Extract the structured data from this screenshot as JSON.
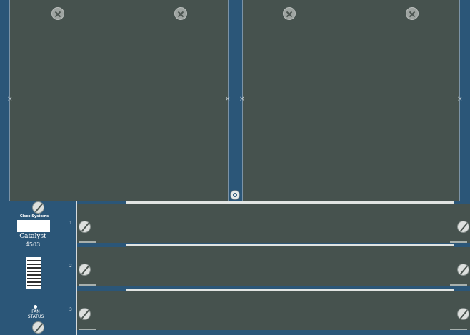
{
  "chassis": {
    "brand": "Cisco Systems",
    "model_name": "Catalyst",
    "model_number": "4503",
    "fan_label_1": "FAN",
    "fan_label_2": "STATUS"
  },
  "slots": [
    {
      "number": "1"
    },
    {
      "number": "2"
    },
    {
      "number": "3"
    }
  ],
  "colors": {
    "chassis_blue": "#2b5678",
    "module_gray": "#424f4a",
    "screw_gray": "#9ea4a1"
  },
  "icons": [
    "screw-icon",
    "thumbscrew-icon",
    "power-connector-icon",
    "fan-vent-icon",
    "status-led-icon"
  ]
}
